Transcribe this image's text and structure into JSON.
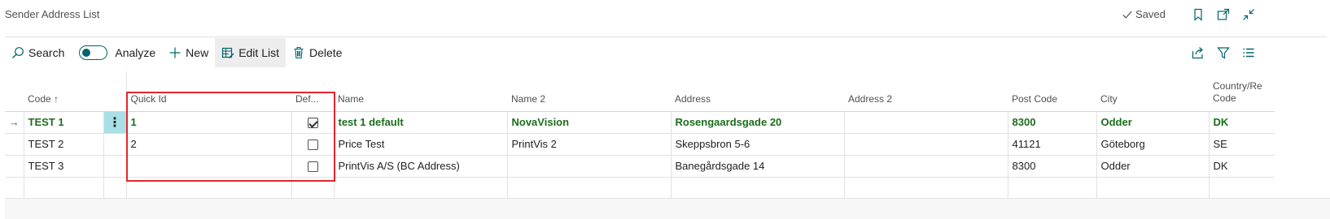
{
  "page": {
    "title": "Sender Address List",
    "status": "Saved"
  },
  "titlebar_icons": [
    "bookmark-icon",
    "open-in-new-window-icon",
    "collapse-icon"
  ],
  "actions": {
    "search": "Search",
    "analyze": "Analyze",
    "analyze_on": false,
    "new": "New",
    "edit_list": "Edit List",
    "delete": "Delete"
  },
  "right_icons": [
    "share-icon",
    "filter-icon",
    "list-view-icon"
  ],
  "table": {
    "columns": {
      "code": "Code ↑",
      "quick_id": "Quick Id",
      "default": "Def...",
      "name": "Name",
      "name2": "Name 2",
      "address": "Address",
      "address2": "Address 2",
      "post_code": "Post Code",
      "city": "City",
      "country_line1": "Country/Re",
      "country_line2": "Code"
    },
    "rows": [
      {
        "code": "TEST 1",
        "quick_id": "1",
        "default": true,
        "name": "test 1 default",
        "name2": "NovaVision",
        "address": "Rosengaardsgade 20",
        "address2": "",
        "post_code": "8300",
        "city": "Odder",
        "country": "DK"
      },
      {
        "code": "TEST 2",
        "quick_id": "2",
        "default": false,
        "name": "Price Test",
        "name2": "PrintVis 2",
        "address": "Skeppsbron 5-6",
        "address2": "",
        "post_code": "41121",
        "city": "Göteborg",
        "country": "SE"
      },
      {
        "code": "TEST 3",
        "quick_id": "",
        "default": false,
        "name": "PrintVis A/S (BC Address)",
        "name2": "",
        "address": "Banegårdsgade 14",
        "address2": "",
        "post_code": "8300",
        "city": "Odder",
        "country": "DK"
      }
    ],
    "current_row_arrow": "→",
    "row_menu_glyph": "⋮"
  },
  "colors": {
    "accent": "#00656b",
    "highlight_text": "#1b6d1b",
    "annotation_box": "#e3262c",
    "row_menu_bg": "#a8e0e6"
  }
}
